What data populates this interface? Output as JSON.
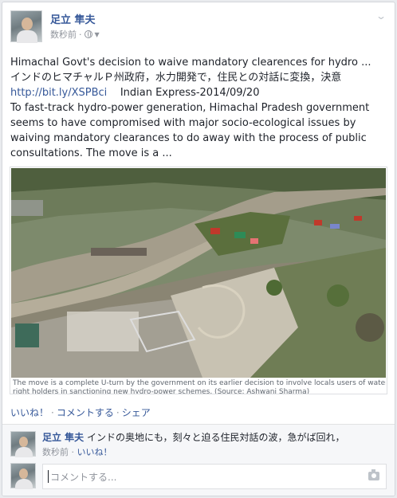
{
  "post": {
    "author": "足立 隼夫",
    "time": "数秒前",
    "separator": "·",
    "text_lines": [
      "Himachal Govt's decision to waive mandatory clearences for hydro ...",
      "インドのヒマチャルＰ州政府，水力開発で，住民との対話に変換，決意"
    ],
    "link": "http://bit.ly/XSPBci",
    "source": "Indian Express-2014/09/20",
    "body_lines": [
      "To fast-track hydro-power generation, Himachal Pradesh government",
      "seems to have compromised with major socio-ecological issues by",
      "waiving mandatory clearances to do away with the process of public",
      "consultations. The move is a ..."
    ],
    "photo_caption_lines": [
      "The move is a complete U-turn by the government on its earlier decision to involve locals users of water and other",
      "right holders in sanctioning new hydro-power schemes. (Source: Ashwani Sharma)"
    ]
  },
  "actions": {
    "like": "いいね！",
    "comment": "コメントする",
    "share": "シェア",
    "sep": "·"
  },
  "comment": {
    "author": "足立 隼夫",
    "text": "インドの奥地にも，刻々と迫る住民対話の波，急がば回れ，",
    "time": "数秒前",
    "like": "いいね！",
    "sep": "·"
  },
  "reply": {
    "placeholder": "コメントする..."
  },
  "colors": {
    "link": "#365899",
    "meta": "#90949c",
    "background": "#e9ebee"
  },
  "icons": [
    "globe-icon",
    "chevron-down-icon",
    "camera-icon"
  ]
}
